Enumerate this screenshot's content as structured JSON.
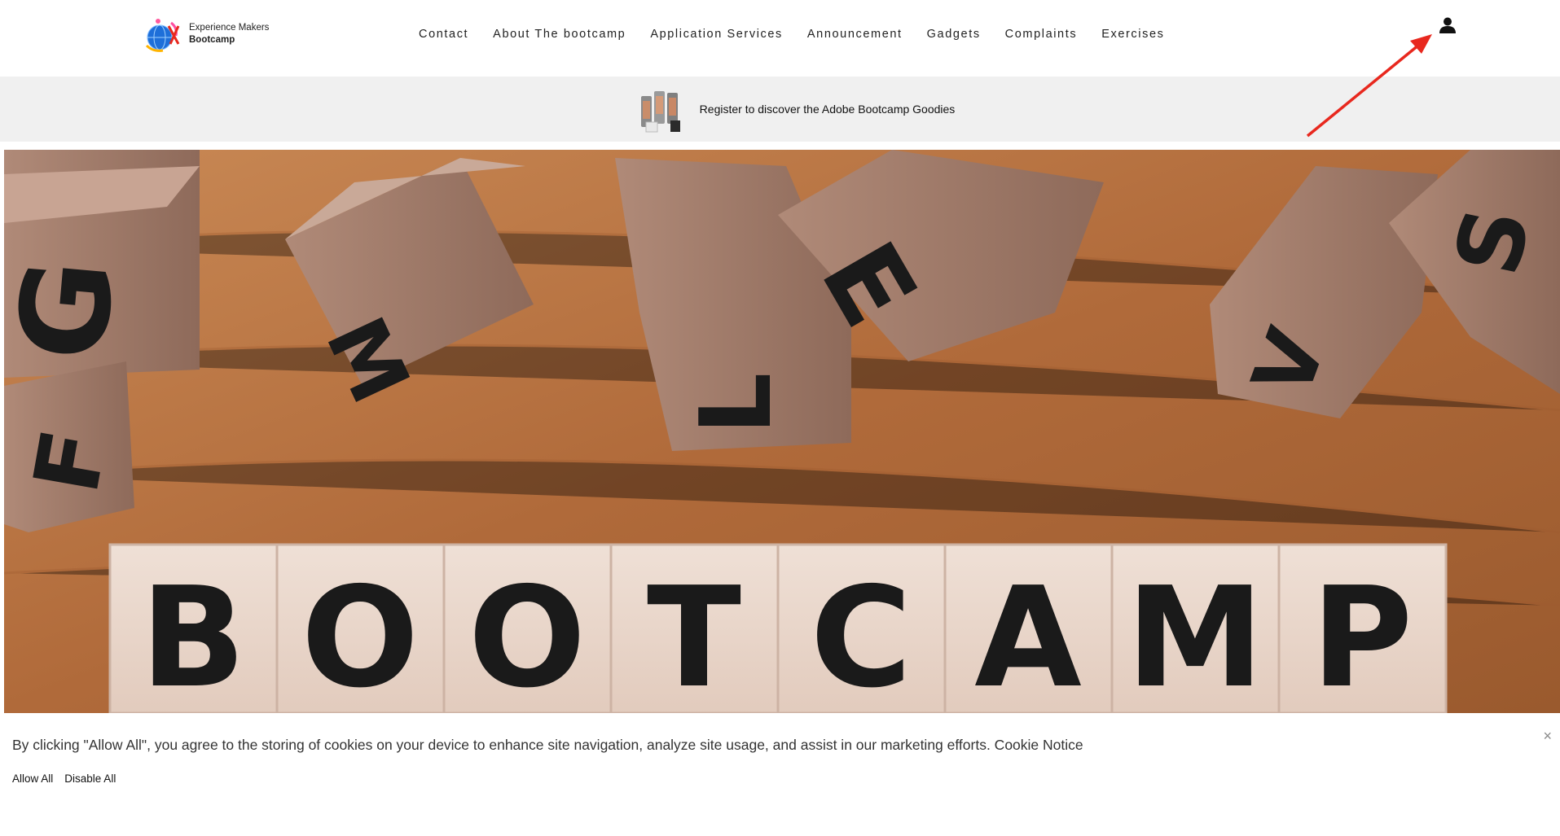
{
  "brand": {
    "line1": "Experience Makers",
    "line2": "Bootcamp"
  },
  "nav": {
    "items": [
      {
        "label": "Contact"
      },
      {
        "label": "About The bootcamp"
      },
      {
        "label": "Application Services"
      },
      {
        "label": "Announcement"
      },
      {
        "label": "Gadgets"
      },
      {
        "label": "Complaints"
      },
      {
        "label": "Exercises"
      }
    ]
  },
  "promo": {
    "text": "Register to discover the Adobe Bootcamp Goodies"
  },
  "hero": {
    "tiles": [
      "B",
      "O",
      "O",
      "T",
      "C",
      "A",
      "M",
      "P"
    ],
    "scattered": [
      "G",
      "M",
      "L",
      "E",
      "V",
      "S",
      "F"
    ]
  },
  "cookie": {
    "text": "By clicking \"Allow All\", you agree to the storing of cookies on your device to enhance site navigation, analyze site usage, and assist in our marketing efforts. Cookie Notice",
    "allow_label": "Allow All",
    "disable_label": "Disable All",
    "close_glyph": "×"
  },
  "colors": {
    "annotation": "#e8281e",
    "adobe_red": "#d0021b",
    "promo_bg": "#f0f0f0"
  }
}
